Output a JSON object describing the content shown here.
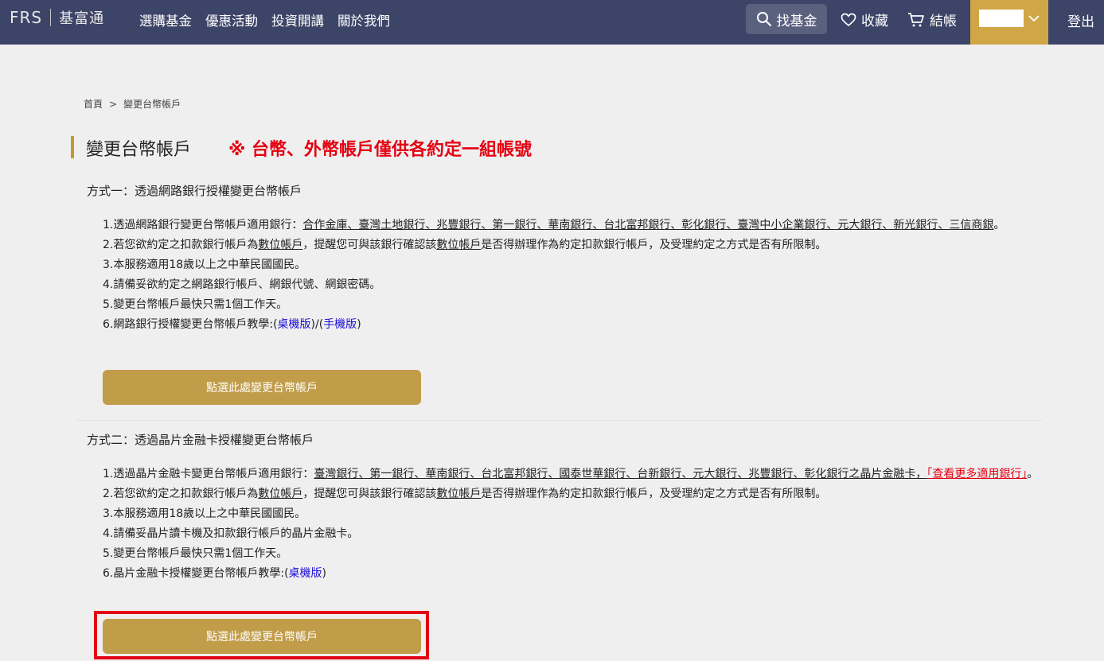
{
  "nav": {
    "logo_brand": "FRS",
    "logo_cn": "基富通",
    "menu": [
      "選購基金",
      "優惠活動",
      "投資開講",
      "關於我們"
    ],
    "search": "找基金",
    "favorites": "收藏",
    "checkout": "結帳",
    "logout": "登出",
    "accent_color": "#d1a646",
    "bg_color": "#3c4467"
  },
  "breadcrumb": {
    "home": "首頁",
    "separator": ">",
    "current": "變更台幣帳戶"
  },
  "page": {
    "title": "變更台幣帳戶",
    "warning": "※ 台幣、外幣帳戶僅供各約定一組帳號"
  },
  "method1": {
    "title": "方式一：透過網路銀行授權變更台幣帳戶",
    "item1_prefix": "1.透過網路銀行變更台幣帳戶適用銀行：",
    "item1_banks": "合作金庫、臺灣土地銀行、兆豐銀行、第一銀行、華南銀行、台北富邦銀行、彰化銀行、臺灣中小企業銀行、元大銀行、新光銀行、三信商銀",
    "item1_suffix": "。",
    "item2_a": "2.若您欲約定之扣款銀行帳戶為",
    "item2_digital": "數位帳戶",
    "item2_b": "，提醒您可與該銀行確認該",
    "item2_c": "是否得辦理作為約定扣款銀行帳戶，及受理約定之方式是否有所限制。",
    "item3": "3.本服務適用18歲以上之中華民國國民。",
    "item4": "4.請備妥欲約定之網路銀行帳戶、網銀代號、網銀密碼。",
    "item5": "5.變更台幣帳戶最快只需1個工作天。",
    "item6_prefix": "6.網路銀行授權變更台幣帳戶教學:(",
    "item6_desktop": "桌機版",
    "item6_mid": ")/(",
    "item6_mobile": "手機版",
    "item6_end": ")",
    "button": "點選此處變更台幣帳戶"
  },
  "method2": {
    "title": "方式二：透過晶片金融卡授權變更台幣帳戶",
    "item1_prefix": "1.透過晶片金融卡變更台幣帳戶適用銀行：",
    "item1_banks": "臺灣銀行、第一銀行、華南銀行、台北富邦銀行、國泰世華銀行、台新銀行、元大銀行、兆豐銀行、彰化銀行之晶片金融卡，",
    "item1_more": "「查看更多適用銀行」",
    "item1_suffix": "。",
    "item2_a": "2.若您欲約定之扣款銀行帳戶為",
    "item2_digital": "數位帳戶",
    "item2_b": "，提醒您可與該銀行確認該",
    "item2_c": "是否得辦理作為約定扣款銀行帳戶，及受理約定之方式是否有所限制。",
    "item3": "3.本服務適用18歲以上之中華民國國民。",
    "item4": "4.請備妥晶片讀卡機及扣款銀行帳戶的晶片金融卡。",
    "item5": "5.變更台幣帳戶最快只需1個工作天。",
    "item6_prefix": "6.晶片金融卡授權變更台幣帳戶教學:(",
    "item6_desktop": "桌機版",
    "item6_end": ")",
    "button": "點選此處變更台幣帳戶"
  }
}
